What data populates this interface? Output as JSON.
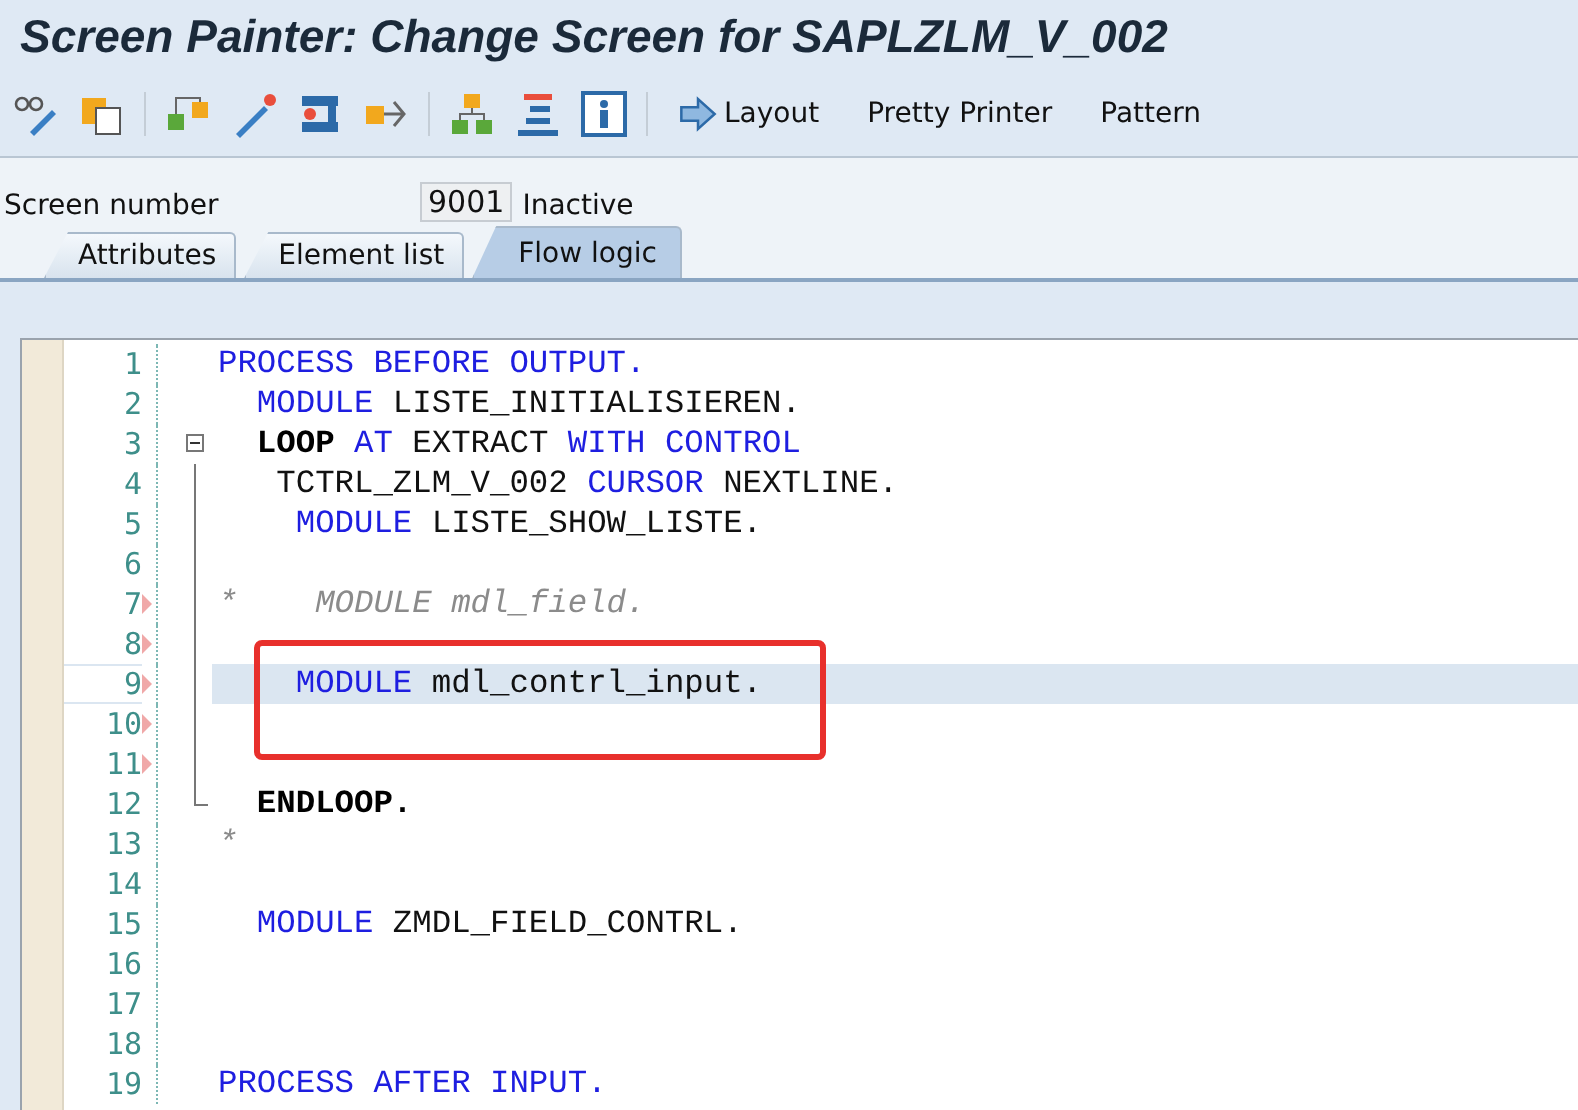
{
  "window": {
    "title": "Screen Painter: Change Screen for SAPLZLM_V_002"
  },
  "toolbar": {
    "buttons": [
      {
        "label": "Layout",
        "kind": "arrow"
      },
      {
        "label": "Pretty Printer",
        "kind": "text"
      },
      {
        "label": "Pattern",
        "kind": "text"
      }
    ]
  },
  "screen_number": {
    "label": "Screen number",
    "value": "9001",
    "status": "Inactive"
  },
  "tabs": [
    {
      "label": "Attributes",
      "selected": false
    },
    {
      "label": "Element list",
      "selected": false
    },
    {
      "label": "Flow logic",
      "selected": true
    }
  ],
  "editor": {
    "lines": [
      {
        "number": "1",
        "tokens": [
          {
            "kind": "kw",
            "text": "PROCESS BEFORE OUTPUT."
          }
        ]
      },
      {
        "number": "2",
        "tokens": [
          {
            "kind": "kw",
            "text": "  MODULE"
          },
          {
            "kind": "text",
            "text": " LISTE_INITIALISIEREN."
          }
        ]
      },
      {
        "number": "3",
        "expanded": true,
        "tokens": [
          {
            "kind": "strong",
            "text": "  LOOP"
          },
          {
            "kind": "kw",
            "text": " AT"
          },
          {
            "kind": "text",
            "text": " EXTRACT"
          },
          {
            "kind": "kw",
            "text": " WITH CONTROL"
          }
        ]
      },
      {
        "number": "4",
        "tokens": [
          {
            "kind": "text",
            "text": "   TCTRL_ZLM_V_002"
          },
          {
            "kind": "kw",
            "text": " CURSOR"
          },
          {
            "kind": "text",
            "text": " NEXTLINE."
          }
        ]
      },
      {
        "number": "5",
        "tokens": [
          {
            "kind": "kw",
            "text": "    MODULE"
          },
          {
            "kind": "text",
            "text": " LISTE_SHOW_LISTE."
          }
        ]
      },
      {
        "number": "6"
      },
      {
        "number": "7",
        "changed": true,
        "tokens": [
          {
            "kind": "comment",
            "text": "*    MODULE mdl_field."
          }
        ]
      },
      {
        "number": "8",
        "changed": true
      },
      {
        "number": "9",
        "changed": true,
        "selected": true,
        "tokens": [
          {
            "kind": "kw",
            "text": "    MODULE"
          },
          {
            "kind": "text",
            "text": " mdl_contrl_input."
          }
        ]
      },
      {
        "number": "10",
        "changed": true
      },
      {
        "number": "11",
        "changed": true
      },
      {
        "number": "12",
        "fold_end": true,
        "tokens": [
          {
            "kind": "strong",
            "text": "  ENDLOOP."
          }
        ]
      },
      {
        "number": "13",
        "tokens": [
          {
            "kind": "comment",
            "text": "*"
          }
        ]
      },
      {
        "number": "14"
      },
      {
        "number": "15",
        "tokens": [
          {
            "kind": "kw",
            "text": "  MODULE"
          },
          {
            "kind": "text",
            "text": " ZMDL_FIELD_CONTRL."
          }
        ]
      },
      {
        "number": "16"
      },
      {
        "number": "17"
      },
      {
        "number": "18"
      },
      {
        "number": "19",
        "tokens": [
          {
            "kind": "kw",
            "text": "PROCESS AFTER INPUT."
          }
        ]
      }
    ]
  }
}
